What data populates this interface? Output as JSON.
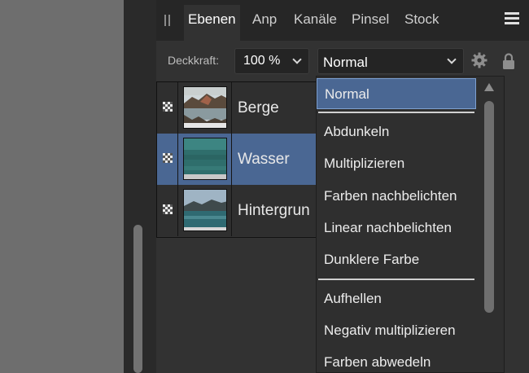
{
  "tabs": [
    {
      "label": "Ebenen",
      "active": true
    },
    {
      "label": "Anp",
      "active": false
    },
    {
      "label": "Kanäle",
      "active": false
    },
    {
      "label": "Pinsel",
      "active": false
    },
    {
      "label": "Stock",
      "active": false
    }
  ],
  "controls": {
    "opacity_label": "Deckkraft:",
    "opacity_value": "100 %",
    "blend_mode_value": "Normal"
  },
  "layers": [
    {
      "name": "Berge",
      "selected": false
    },
    {
      "name": "Wasser",
      "selected": true
    },
    {
      "name": "Hintergrun",
      "selected": false
    }
  ],
  "blend_dropdown": {
    "items": [
      "Normal",
      "Abdunkeln",
      "Multiplizieren",
      "Farben nachbelichten",
      "Linear nachbelichten",
      "Dunklere Farbe",
      "Aufhellen",
      "Negativ multiplizieren",
      "Farben abwedeln"
    ],
    "selected_index": 0
  },
  "colors": {
    "selection": "#4a6793",
    "panel_bg": "#323232",
    "tabbar_bg": "#262626"
  },
  "icons": [
    "grip-icon",
    "hamburger-menu-icon",
    "chevron-down-icon",
    "gear-icon",
    "lock-icon",
    "visibility-checker-icon"
  ]
}
